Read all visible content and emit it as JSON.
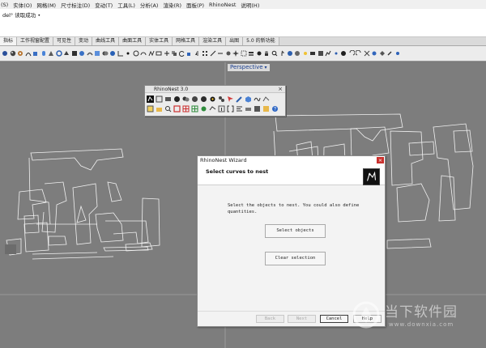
{
  "menubar": {
    "items": [
      "(S)",
      "实体(O)",
      "网格(M)",
      "尺寸标注(D)",
      "变动(T)",
      "工具(L)",
      "分析(A)",
      "渲染(R)",
      "面板(P)",
      "RhinoNest",
      "说明(H)"
    ]
  },
  "command": {
    "line": "del° 读取成功 •"
  },
  "tabs": {
    "items": [
      "指标",
      "工作视窗配置",
      "可见性",
      "变动",
      "曲线工具",
      "曲面工具",
      "实体工具",
      "网格工具",
      "渲染工具",
      "出图",
      "5.0 的新功能"
    ]
  },
  "viewport": {
    "label": "Perspective",
    "dropdown_arrow": "▾"
  },
  "rhinonest_toolbar": {
    "title": "RhinoNest 3.0",
    "close": "×"
  },
  "wizard": {
    "title": "RhinoNest Wizard",
    "heading": "Select curves to nest",
    "close": "×",
    "instruction": "Select the objects to nest. You could also define quantities.",
    "select_button": "Select objects",
    "clear_button": "Clear selection",
    "back_button": "Back",
    "next_button": "Next",
    "cancel_button": "Cancel",
    "help_button": "Help"
  },
  "watermark": {
    "text": "当下软件园",
    "url": "www.downxia.com"
  },
  "colors": {
    "viewport_bg": "#7d7d7d",
    "linework": "#ffffff",
    "wizard_close": "#c9302c",
    "viewport_label": "#1b3f8e"
  }
}
